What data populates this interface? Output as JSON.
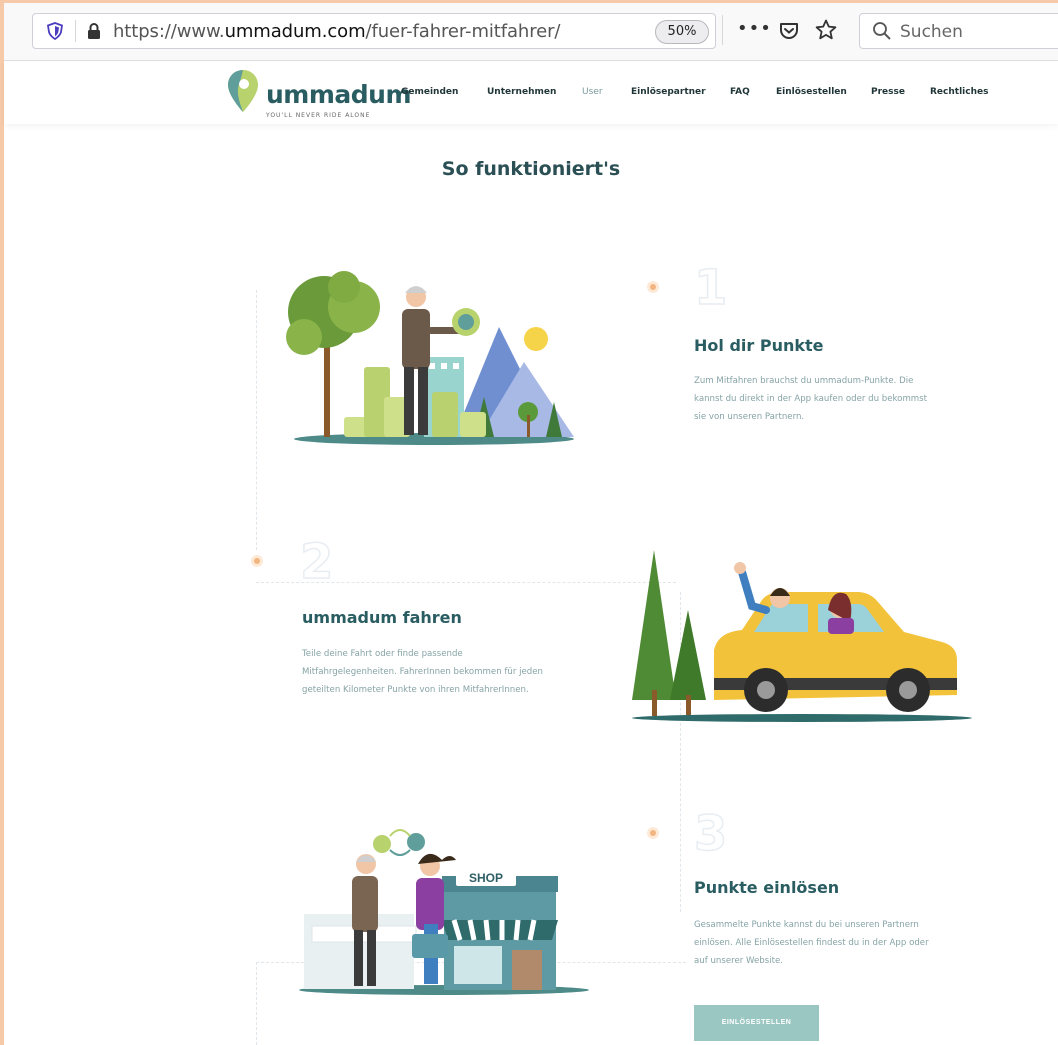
{
  "browser": {
    "url_prefix": "https://www.",
    "url_domain": "ummadum.com",
    "url_path": "/fuer-fahrer-mitfahrer/",
    "zoom": "50%",
    "more_label": "•••",
    "search_placeholder": "Suchen"
  },
  "site": {
    "logo_text": "ummadum",
    "logo_tagline": "YOU'LL NEVER RIDE ALONE",
    "nav": [
      "Gemeinden",
      "Unternehmen",
      "User",
      "Einlösepartner",
      "FAQ",
      "Einlösestellen",
      "Presse",
      "Rechtliches"
    ],
    "active_nav": "User",
    "heading": "So funktioniert's",
    "steps": [
      {
        "number": "1",
        "title": "Hol dir Punkte",
        "text": "Zum Mitfahren brauchst du ummadum-Punkte. Die kannst du direkt in der App kaufen oder du bekommst sie von unseren Partnern."
      },
      {
        "number": "2",
        "title": "ummadum fahren",
        "text": "Teile deine Fahrt oder finde passende Mitfahrgelegenheiten. FahrerInnen bekommen für jeden geteilten Kilometer Punkte von ihren MitfahrerInnen."
      },
      {
        "number": "3",
        "title": "Punkte einlösen",
        "text": "Gesammelte Punkte kannst du bei unseren Partnern einlösen. Alle Einlösestellen findest du in der App oder auf unserer Website.",
        "button": "EINLÖSESTELLEN"
      }
    ],
    "shop_sign": "SHOP"
  },
  "colors": {
    "brand": "#2a5d62",
    "accent": "#9bc7c2",
    "dot": "#f3b580"
  }
}
